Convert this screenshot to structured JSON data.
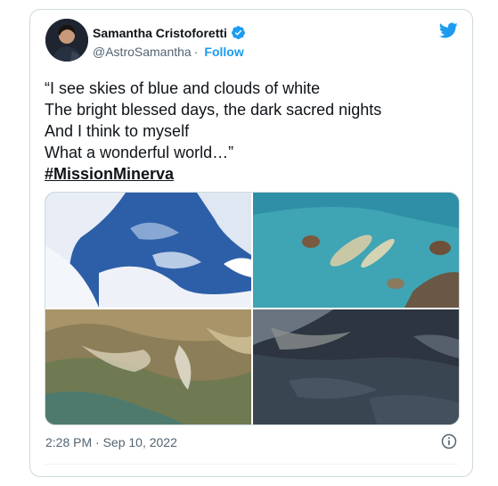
{
  "tweet": {
    "author_name": "Samantha Cristoforetti",
    "handle": "@AstroSamantha",
    "separator": "·",
    "follow_label": "Follow",
    "text_lines": [
      "“I see skies of blue and clouds of white",
      "The bright blessed days, the dark sacred nights",
      "And I think to myself",
      "What a wonderful world…”"
    ],
    "hashtag": "#MissionMinerva",
    "timestamp": "2:28 PM · Sep 10, 2022",
    "photos": [
      "earth-clouds-ocean",
      "turquoise-islands",
      "desert-terrain",
      "dark-ocean-clouds"
    ]
  },
  "icons": {
    "verified": "verified-badge-icon",
    "brand": "twitter-bird-icon",
    "info": "info-icon"
  },
  "colors": {
    "accent": "#1d9bf0",
    "text": "#0f1419",
    "muted": "#536471",
    "border": "#cfd9de"
  }
}
